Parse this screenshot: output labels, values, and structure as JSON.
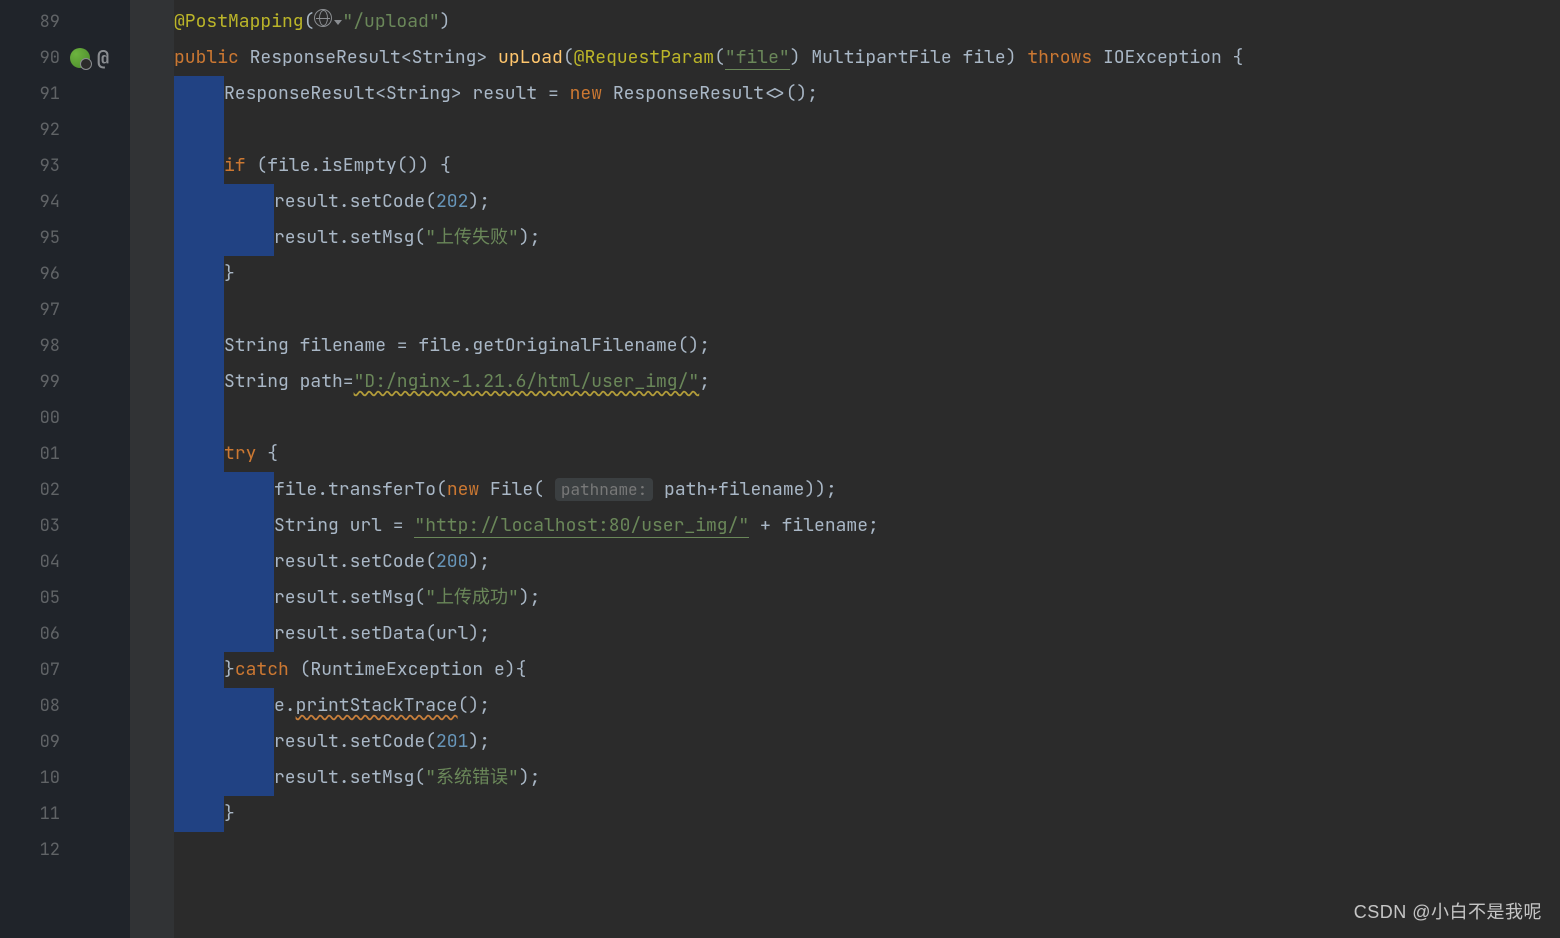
{
  "watermark": "CSDN @小白不是我呢",
  "gutter": {
    "start": 89,
    "lines": [
      {
        "n": "89"
      },
      {
        "n": "90",
        "icons": [
          "spring",
          "at"
        ]
      },
      {
        "n": "91"
      },
      {
        "n": "92"
      },
      {
        "n": "93"
      },
      {
        "n": "94"
      },
      {
        "n": "95"
      },
      {
        "n": "96"
      },
      {
        "n": "97"
      },
      {
        "n": "98"
      },
      {
        "n": "99"
      },
      {
        "n": "00"
      },
      {
        "n": "01"
      },
      {
        "n": "02"
      },
      {
        "n": "03"
      },
      {
        "n": "04"
      },
      {
        "n": "05"
      },
      {
        "n": "06"
      },
      {
        "n": "07"
      },
      {
        "n": "08"
      },
      {
        "n": "09"
      },
      {
        "n": "10"
      },
      {
        "n": "11"
      },
      {
        "n": "12"
      }
    ]
  },
  "tokens": {
    "l89_ann": "@PostMapping",
    "l89_paren_o": "(",
    "l89_str": "\"/upload\"",
    "l89_paren_c": ")",
    "l90_kw1": "public",
    "l90_type1": "ResponseResult",
    "l90_gen1": "<String>",
    "l90_m": "upLoad",
    "l90_p": "(",
    "l90_ann": "@RequestParam",
    "l90_p2": "(",
    "l90_str": "\"file\"",
    "l90_p3": ")",
    "l90_type2": "MultipartFile ",
    "l90_var": "file",
    "l90_p4": ") ",
    "l90_kw2": "throws",
    "l90_type3": " IOException {",
    "l91_a": "ResponseResult<String> result = ",
    "l91_kw": "new",
    "l91_b": " ResponseResult<>();",
    "l93_kw": "if",
    "l93_b": " (file.isEmpty()) {",
    "l94_a": "result.setCode(",
    "l94_num": "202",
    "l94_b": ");",
    "l95_a": "result.setMsg(",
    "l95_str": "\"",
    "l95_cn": "上传失败",
    "l95_str2": "\"",
    "l95_b": ");",
    "l96": "}",
    "l98": "String filename = file.getOriginalFilename();",
    "l99_a": "String path=",
    "l99_str": "\"D:/nginx-1.21.6/html/user_img/\"",
    "l99_b": ";",
    "l101_kw": "try",
    "l101_b": " {",
    "l102_a": "file.transferTo(",
    "l102_kw": "new",
    "l102_b": " File(",
    "l102_hint": "pathname:",
    "l102_c": " path+filename));",
    "l103_a": "String url = ",
    "l103_str": "\"http://localhost:80/user_img/\"",
    "l103_b": " + filename;",
    "l104_a": "result.setCode(",
    "l104_num": "200",
    "l104_b": ");",
    "l105_a": "result.setMsg(",
    "l105_str": "\"",
    "l105_cn": "上传成功",
    "l105_str2": "\"",
    "l105_b": ");",
    "l106": "result.setData(url);",
    "l107_a": "}",
    "l107_kw": "catch",
    "l107_b": " (RuntimeException e){",
    "l108_a": "e.",
    "l108_call": "printStackTrace",
    "l108_b": "();",
    "l109_a": "result.setCode(",
    "l109_num": "201",
    "l109_b": ");",
    "l110_a": "result.setMsg(",
    "l110_str": "\"",
    "l110_cn": "系统错误",
    "l110_str2": "\"",
    "l110_b": ");",
    "l111": "}"
  }
}
